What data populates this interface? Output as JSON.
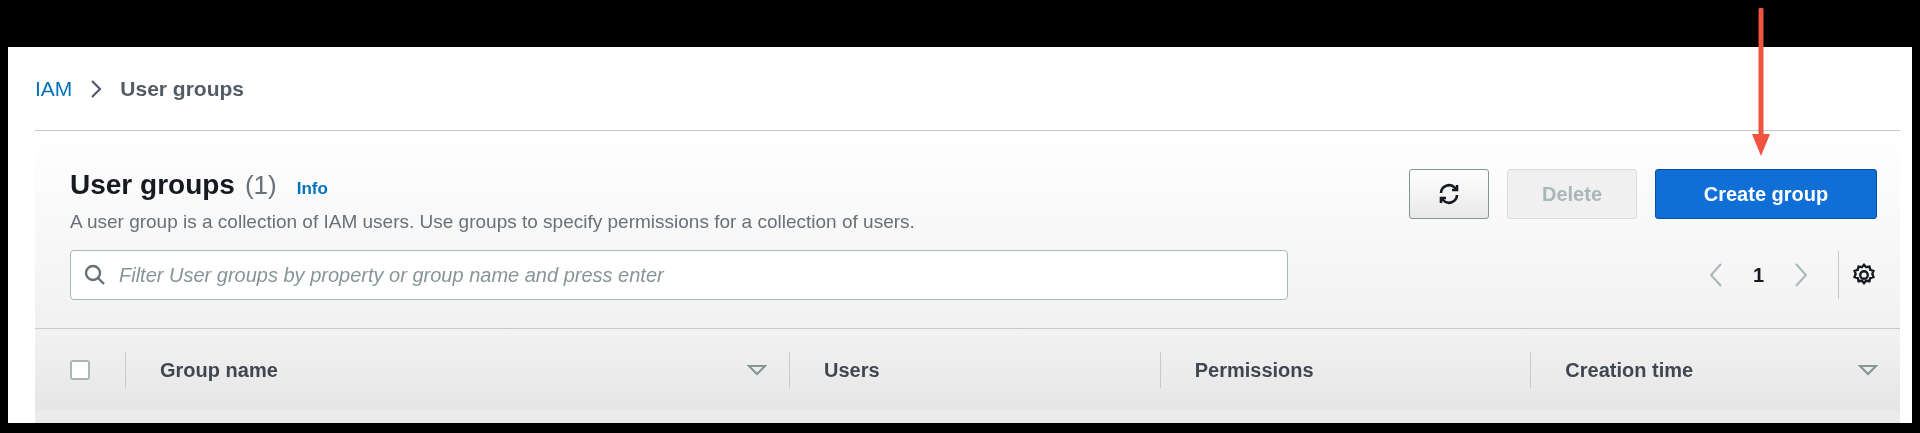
{
  "breadcrumb": [
    {
      "label": "IAM",
      "kind": "link"
    },
    {
      "label": "User groups",
      "kind": "current"
    }
  ],
  "header": {
    "title": "User groups",
    "count": "(1)",
    "info": "Info",
    "description": "A user group is a collection of IAM users. Use groups to specify permissions for a collection of users."
  },
  "actions": [
    {
      "kind": "refresh",
      "disabled": false
    },
    {
      "kind": "text",
      "label": "Delete",
      "disabled": true
    },
    {
      "kind": "primary",
      "label": "Create group",
      "disabled": false
    }
  ],
  "search": {
    "placeholder": "Filter User groups by property or group name and press enter"
  },
  "pagination": {
    "page": "1"
  },
  "table": {
    "select_all": {
      "checked": false
    },
    "columns": [
      {
        "label": "Group name",
        "kind": "sortable"
      },
      {
        "label": "Users",
        "kind": "plain"
      },
      {
        "label": "Permissions",
        "kind": "plain"
      },
      {
        "label": "Creation time",
        "kind": "sortable"
      }
    ]
  }
}
